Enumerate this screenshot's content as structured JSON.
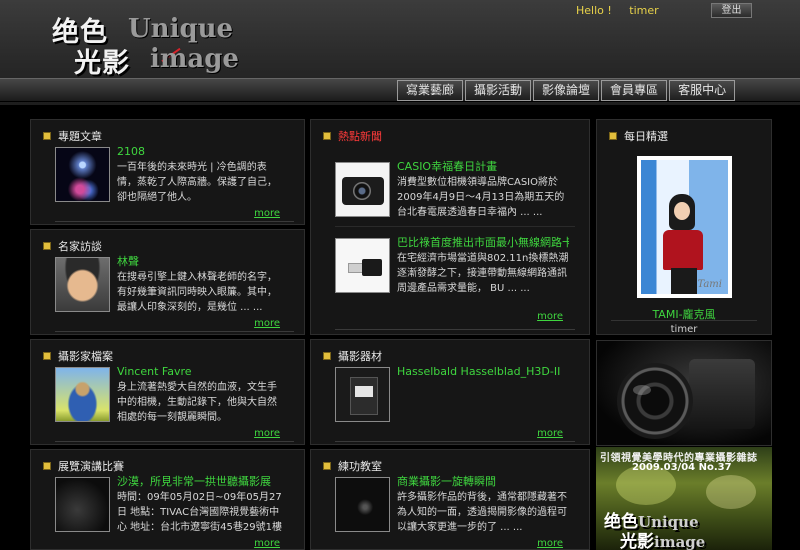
{
  "header": {
    "logo_line1_cjk": "绝色",
    "logo_line1_en": "Unique",
    "logo_line2_cjk": "光影",
    "logo_line2_en": "image",
    "greeting": "Hello !",
    "username": "timer",
    "logout_label": "登出"
  },
  "nav": {
    "tabs": [
      "寫業藝廊",
      "攝影活動",
      "影像論壇",
      "會員專區",
      "客服中心"
    ]
  },
  "more_label": "more",
  "panels": {
    "featured": {
      "title": "專題文章",
      "item_title": "2108",
      "item_desc": "一百年後的未來時光 | 冷色調的表情，蒸乾了人際高牆。保護了自己，卻也隔絕了他人。"
    },
    "interview": {
      "title": "名家訪談",
      "item_title": "林聲",
      "item_desc": "在搜尋引擎上鍵入林聲老師的名字，有好幾筆資訊同時映入眼簾。其中，最讓人印象深刻的，是幾位 ... ..."
    },
    "photographer": {
      "title": "攝影家檔案",
      "item_title": "Vincent Favre",
      "item_desc": "身上流著熱愛大自然的血液，文生手中的相機，生動記錄下，他與大自然相處的每一刻靚麗瞬間。"
    },
    "contest": {
      "title": "展覽演講比賽",
      "item_title": "沙漠，所見非常一拱世聽攝影展",
      "item_desc": "時間：09年05月02日~09年05月27日 地點：TIVAC台灣國際視覺藝術中心 地址：台北市遼寧街45巷29號1樓"
    },
    "news": {
      "title": "熱點新聞",
      "items": [
        {
          "title": "CASIO幸福春日計畫",
          "desc": "消費型數位相機領導品牌CASIO將於2009年4月9日～4月13日為期五天的台北春電展透過春日幸福內 ... ..."
        },
        {
          "title": "巴比祿首度推出市面最小無線網路卡",
          "desc": "在宅經濟市場當道與802.11n換標熱潮逐漸發酵之下，接連帶動無線網路通訊周邊產品需求量能， BU ... ..."
        }
      ]
    },
    "equipment": {
      "title": "攝影器材",
      "item_title": "Hasselbald Hasselblad_H3D-II"
    },
    "classroom": {
      "title": "練功教室",
      "item_title": "商業攝影一旋轉瞬間",
      "item_desc": "許多攝影作品的背後，通常都隱藏著不為人知的一面，透過揭開影像的過程可以讓大家更進一步的了 ... ..."
    },
    "daily": {
      "title": "每日精選",
      "photo_signature": "Tami",
      "photo_title": "TAMI-龐克風",
      "photo_user": "timer"
    }
  },
  "ads": {
    "magazine_slogan": "引領視覺美學時代的專業攝影雜誌",
    "magazine_issue": "2009.03/04 No.37",
    "magazine_logo_cjk1": "绝色",
    "magazine_logo_en1": "Unique",
    "magazine_logo_cjk2": "光影",
    "magazine_logo_en2": "image"
  },
  "colors": {
    "accent_green": "#3fd63f",
    "title_red": "#ff3a3a",
    "greeting_yellow": "#e8d24a",
    "bullet_gold": "#e2be3c"
  }
}
